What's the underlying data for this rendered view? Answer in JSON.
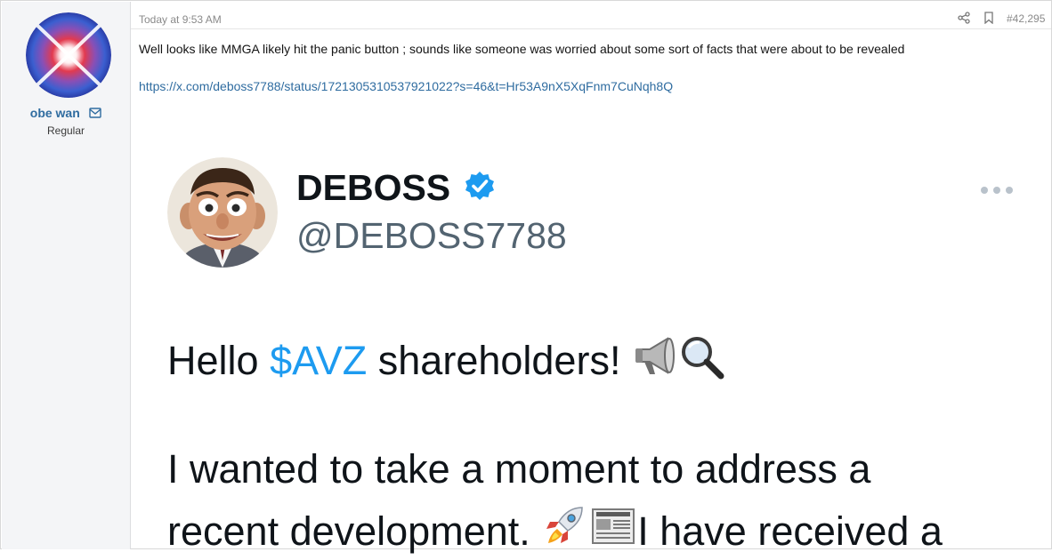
{
  "user": {
    "name": "obe wan",
    "title": "Regular"
  },
  "post": {
    "timestamp": "Today at 9:53 AM",
    "number": "#42,295",
    "text": "Well looks like MMGA likely hit the panic button ; sounds like someone was worried about some sort of facts that were about to be revealed",
    "link": "https://x.com/deboss7788/status/1721305310537921022?s=46&t=Hr53A9nX5XqFnm7CuNqh8Q"
  },
  "embed": {
    "display_name": "DEBOSS",
    "handle": "@DEBOSS7788",
    "line1_before": "Hello ",
    "cashtag": "$AVZ",
    "line1_after": " shareholders! ",
    "line2": "I wanted to take a moment to address a",
    "line3_before": "recent development. ",
    "line3_after": "I have received a"
  },
  "icons": {
    "mail": "envelope-icon",
    "share": "share-icon",
    "bookmark": "bookmark-icon",
    "verified": "verified-badge-icon",
    "more": "more-options-icon",
    "megaphone": "loudspeaker-emoji",
    "magnifier": "magnifying-glass-emoji",
    "rocket": "rocket-emoji",
    "newspaper": "newspaper-emoji"
  },
  "colors": {
    "link": "#2f6ca0",
    "cashtag": "#1d9bf0",
    "verified": "#1d9bf0",
    "sidebar_bg": "#f4f5f7"
  }
}
